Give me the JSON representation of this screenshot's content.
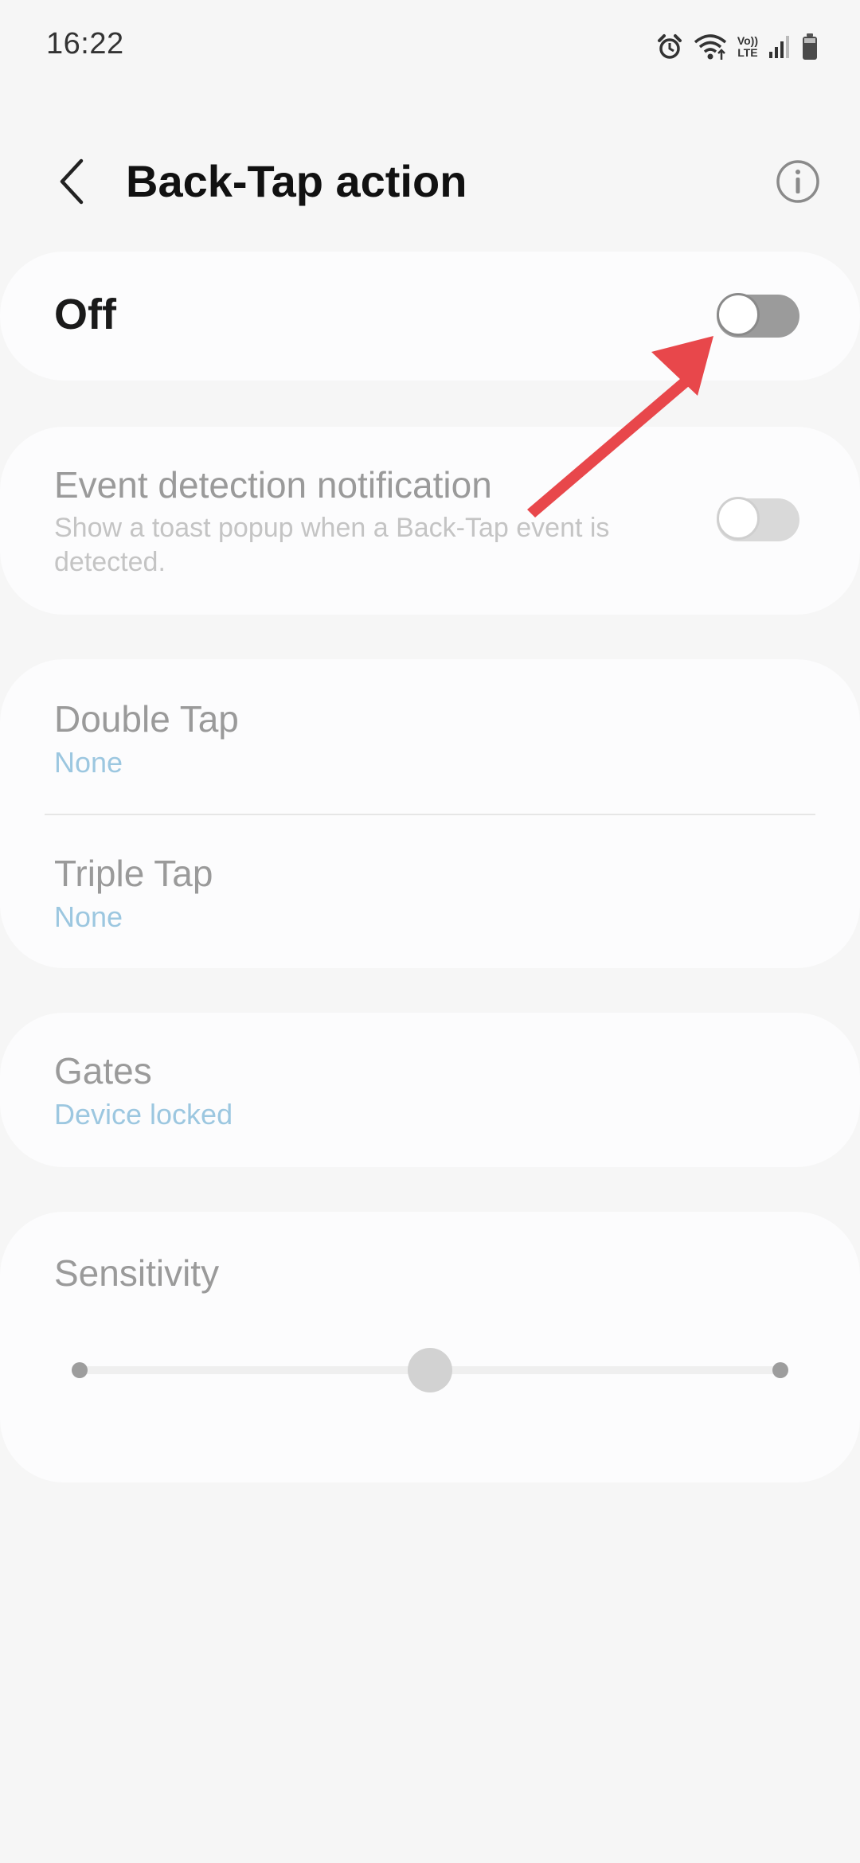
{
  "status_bar": {
    "time": "16:22",
    "icons": [
      "alarm-icon",
      "wifi-icon",
      "volte-icon",
      "signal-icon",
      "battery-icon"
    ],
    "volte_label_top": "Vo))",
    "volte_label_bottom": "LTE"
  },
  "header": {
    "title": "Back-Tap action",
    "back_icon": "chevron-left-icon",
    "info_icon": "info-icon"
  },
  "master_switch": {
    "label": "Off",
    "enabled": false
  },
  "event_notification": {
    "title": "Event detection notification",
    "description": "Show a toast popup when a Back-Tap event is detected.",
    "enabled": false
  },
  "taps": {
    "double_tap": {
      "title": "Double Tap",
      "value": "None"
    },
    "triple_tap": {
      "title": "Triple Tap",
      "value": "None"
    }
  },
  "gates": {
    "title": "Gates",
    "value": "Device locked"
  },
  "sensitivity": {
    "title": "Sensitivity",
    "level": 0.5
  },
  "colors": {
    "background": "#f6f6f6",
    "card": "#fcfcfd",
    "accent_value": "#9cc7e0",
    "annotation_arrow": "#e8474b"
  }
}
